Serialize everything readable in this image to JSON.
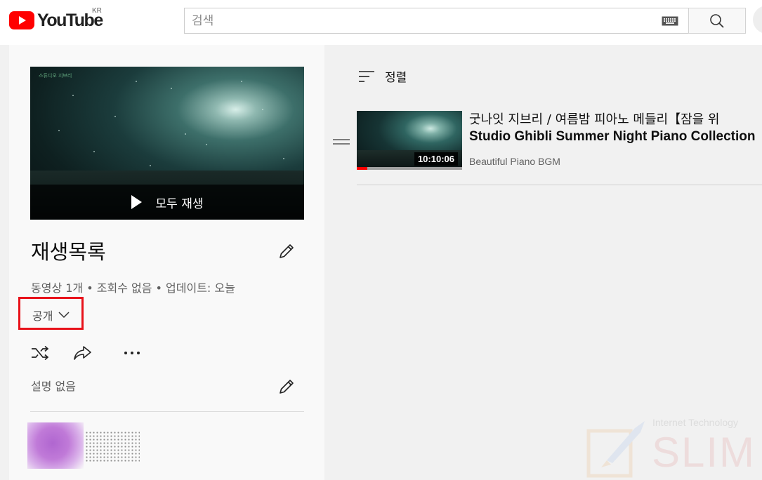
{
  "header": {
    "logo_text": "YouTube",
    "region": "KR",
    "search_placeholder": "검색"
  },
  "playlist": {
    "play_all_label": "모두 재생",
    "title": "재생목록",
    "stats": "동영상 1개 • 조회수 없음 • 업데이트: 오늘",
    "privacy_label": "공개",
    "description": "설명 없음",
    "thumbnail_caption": "스튜디오 지브리"
  },
  "videos_panel": {
    "sort_label": "정렬",
    "items": [
      {
        "title_line1": "굿나잇 지브리 / 여름밤 피아노 메들리【잠을 위",
        "title_line2": "Studio Ghibli Summer Night Piano Collection",
        "channel": "Beautiful Piano BGM",
        "duration": "10:10:06",
        "watched_fraction": 0.1
      }
    ]
  },
  "watermark": {
    "small_text": "Internet Technology",
    "big_text": "SLIM"
  },
  "colors": {
    "youtube_red": "#ff0000",
    "highlight_box": "#e8121a",
    "left_panel_bg": "#f9f9f9",
    "right_panel_bg": "#f1f1f1"
  }
}
